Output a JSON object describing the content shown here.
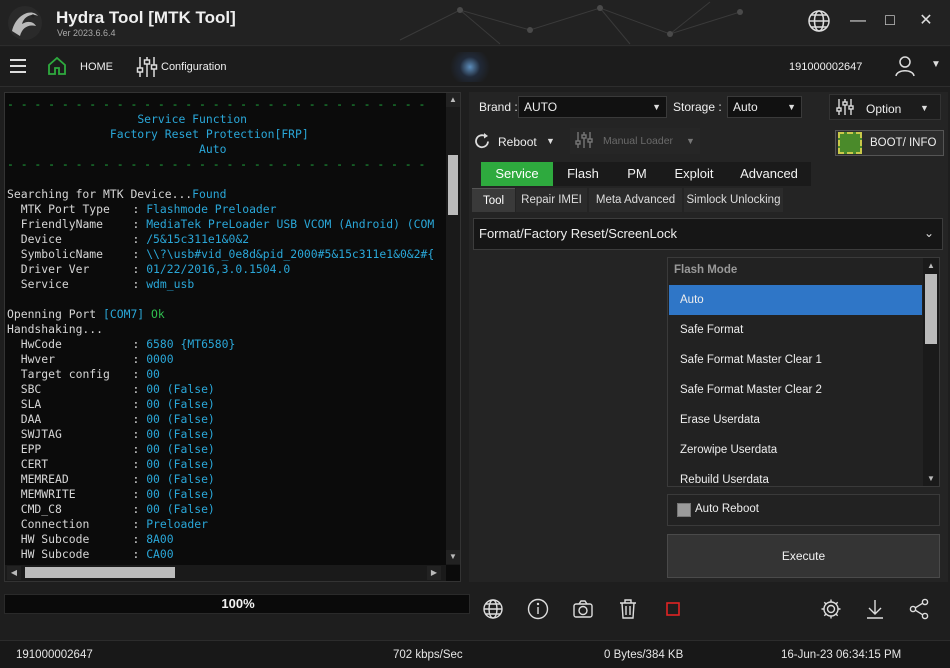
{
  "app": {
    "title": "Hydra Tool [MTK Tool]",
    "version": "Ver 2023.6.6.4"
  },
  "nav": {
    "home_label": "HOME",
    "config_label": "Configuration",
    "serial": "191000002647"
  },
  "console": {
    "header_lines": [
      "Service Function",
      "Factory Reset Protection[FRP]",
      "Auto"
    ],
    "searching_label": "Searching for MTK Device...",
    "searching_status": "Found",
    "device_info": [
      {
        "key": "MTK Port Type",
        "value": "Flashmode Preloader"
      },
      {
        "key": "FriendlyName",
        "value": "MediaTek PreLoader USB VCOM (Android) (COM"
      },
      {
        "key": "Device",
        "value": "/5&15c311e1&0&2"
      },
      {
        "key": "SymbolicName",
        "value": "\\\\?\\usb#vid_0e8d&pid_2000#5&15c311e1&0&2#{"
      },
      {
        "key": "Driver Ver",
        "value": "01/22/2016,3.0.1504.0"
      },
      {
        "key": "Service",
        "value": "wdm_usb"
      }
    ],
    "opening_label": "Openning Port",
    "opening_port": "[COM7]",
    "opening_status": "Ok",
    "handshaking_label": "Handshaking...",
    "hw_info": [
      {
        "key": "HwCode",
        "value": "6580 {MT6580}"
      },
      {
        "key": "Hwver",
        "value": "0000"
      },
      {
        "key": "Target config",
        "value": "00"
      },
      {
        "key": "SBC",
        "value": "00 (False)"
      },
      {
        "key": "SLA",
        "value": "00 (False)"
      },
      {
        "key": "DAA",
        "value": "00 (False)"
      },
      {
        "key": "SWJTAG",
        "value": "00 (False)"
      },
      {
        "key": "EPP",
        "value": "00 (False)"
      },
      {
        "key": "CERT",
        "value": "00 (False)"
      },
      {
        "key": "MEMREAD",
        "value": "00 (False)"
      },
      {
        "key": "MEMWRITE",
        "value": "00 (False)"
      },
      {
        "key": "CMD_C8",
        "value": "00 (False)"
      },
      {
        "key": "Connection",
        "value": "Preloader"
      },
      {
        "key": "HW Subcode",
        "value": "8A00"
      },
      {
        "key": "HW Subcode",
        "value": "CA00"
      }
    ]
  },
  "progress": {
    "label": "100%",
    "value": 1.0
  },
  "controls": {
    "brand_label": "Brand :",
    "brand_value": "AUTO",
    "storage_label": "Storage :",
    "storage_value": "Auto",
    "option_label": "Option",
    "reboot_label": "Reboot",
    "manual_loader_label": "Manual Loader",
    "bootinfo_label": "BOOT/ INFO"
  },
  "main_tabs": [
    "Service",
    "Flash",
    "PM",
    "Exploit",
    "Advanced"
  ],
  "sub_tabs": [
    "Tool",
    "Repair IMEI",
    "Meta Advanced",
    "Simlock Unlocking"
  ],
  "function_select": "Format/Factory Reset/ScreenLock",
  "flash_mode": {
    "title": "Flash Mode",
    "items": [
      "Auto",
      "Safe Format",
      "Safe Format Master Clear 1",
      "Safe Format Master Clear 2",
      "Erase Userdata",
      "Zerowipe Userdata",
      "Rebuild Userdata"
    ],
    "selected": "Auto"
  },
  "auto_reboot_label": "Auto Reboot",
  "execute_label": "Execute",
  "toolbar_icons": [
    "globe-icon",
    "info-icon",
    "camera-icon",
    "trash-icon",
    "stop-icon",
    "settings-icon",
    "download-icon",
    "share-icon"
  ],
  "status": {
    "serial": "191000002647",
    "speed": "702 kbps/Sec",
    "bytes": "0 Bytes/384 KB",
    "datetime": "16-Jun-23 06:34:15 PM"
  },
  "colors": {
    "accent_green": "#2eaa3e",
    "selection_blue": "#2f76c7",
    "console_cyan": "#2aa7d8",
    "console_green": "#2fbf4f"
  }
}
